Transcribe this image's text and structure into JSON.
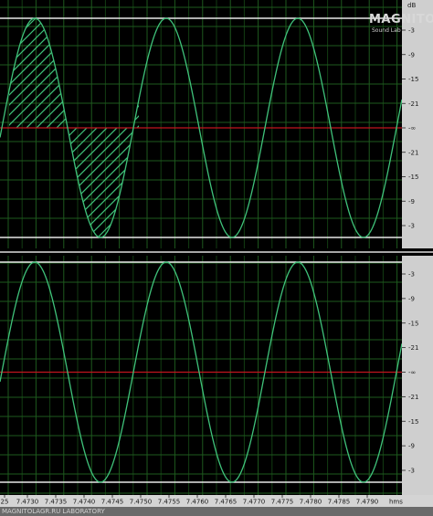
{
  "brand": {
    "name": "MAGNITOLA",
    "sub": "Sound Lab"
  },
  "colors": {
    "background": "#000000",
    "grid": "#1e5a1e",
    "grid_dark": "#123c12",
    "waveform": "#3fc27a",
    "hatch": "#3fc27a",
    "zero_line": "#c0151d",
    "clip_line": "#e8e8e8",
    "ruler_bg": "#d4d4d4",
    "ruler_text": "#1a1a1a",
    "scale_bg": "#cfcfcf",
    "scale_text": "#222222"
  },
  "db_scale": {
    "unit": "dB",
    "channel_top": [
      "-3",
      "-9",
      "-15",
      "-21",
      "-∞",
      "-21",
      "-15",
      "-9",
      "-3"
    ],
    "channel_bottom": [
      "-3",
      "-9",
      "-15",
      "-21",
      "-∞",
      "-21",
      "-15",
      "-9",
      "-3"
    ]
  },
  "time_ruler": {
    "unit": "hms",
    "labels": [
      "25",
      "7.4730",
      "7.4735",
      "7.4740",
      "7.4745",
      "7.4750",
      "7.4755",
      "7.4760",
      "7.4765",
      "7.4770",
      "7.4775",
      "7.4780",
      "7.4785",
      "7.4790"
    ]
  },
  "status_bar": {
    "text": "MAGNITOLAGR.RU LABORATORY"
  }
}
